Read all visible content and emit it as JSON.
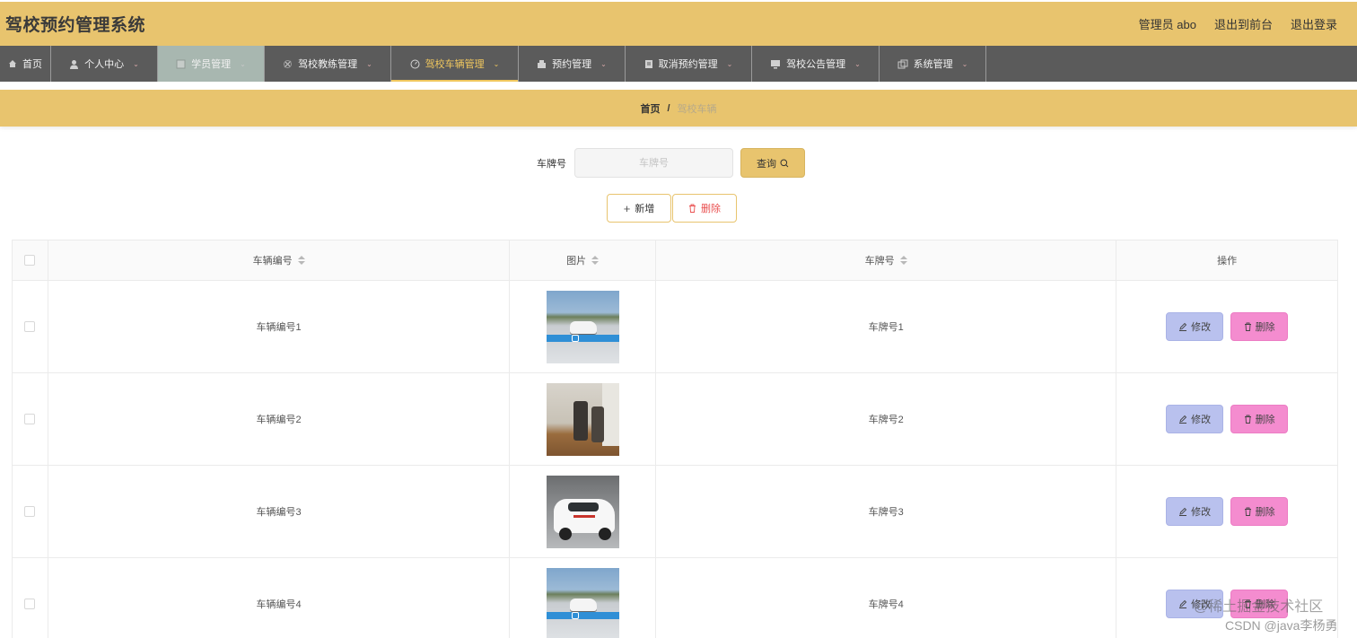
{
  "header": {
    "title": "驾校预约管理系统",
    "admin_label": "管理员 abo",
    "front_link": "退出到前台",
    "logout_link": "退出登录"
  },
  "nav": {
    "items": [
      {
        "label": "首页",
        "icon": "home-icon",
        "has_caret": false
      },
      {
        "label": "个人中心",
        "icon": "user-icon",
        "has_caret": true
      },
      {
        "label": "学员管理",
        "icon": "student-icon",
        "has_caret": true
      },
      {
        "label": "驾校教练管理",
        "icon": "coach-icon",
        "has_caret": true
      },
      {
        "label": "驾校车辆管理",
        "icon": "vehicle-icon",
        "has_caret": true
      },
      {
        "label": "预约管理",
        "icon": "booking-icon",
        "has_caret": true
      },
      {
        "label": "取消预约管理",
        "icon": "cancel-icon",
        "has_caret": true
      },
      {
        "label": "驾校公告管理",
        "icon": "notice-icon",
        "has_caret": true
      },
      {
        "label": "系统管理",
        "icon": "system-icon",
        "has_caret": true
      }
    ],
    "active_index": 4
  },
  "breadcrumb": {
    "home": "首页",
    "separator": "/",
    "current": "驾校车辆"
  },
  "search": {
    "label": "车牌号",
    "placeholder": "车牌号",
    "value": "",
    "query_button": "查询"
  },
  "actions": {
    "add_label": "新增",
    "delete_label": "删除"
  },
  "table": {
    "columns": [
      "车辆编号",
      "图片",
      "车牌号",
      "操作"
    ],
    "rows": [
      {
        "number": "车辆编号1",
        "image": "training-ground-photo",
        "plate": "车牌号1"
      },
      {
        "number": "车辆编号2",
        "image": "car-interior-photo",
        "plate": "车牌号2"
      },
      {
        "number": "车辆编号3",
        "image": "white-training-car-photo",
        "plate": "车牌号3"
      },
      {
        "number": "车辆编号4",
        "image": "training-ground-photo",
        "plate": "车牌号4"
      }
    ],
    "edit_label": "修改",
    "delete_label": "删除"
  },
  "watermark": {
    "line1": "@稀土掘金技术社区",
    "line2": "CSDN @java李杨勇"
  },
  "colors": {
    "header_bg": "#e8c46e",
    "nav_bg": "#5b5b5b",
    "nav_active": "#f0c75e",
    "edit_btn": "#b9c1ee",
    "delete_btn": "#f48ccf",
    "danger_text": "#e94f4f"
  }
}
